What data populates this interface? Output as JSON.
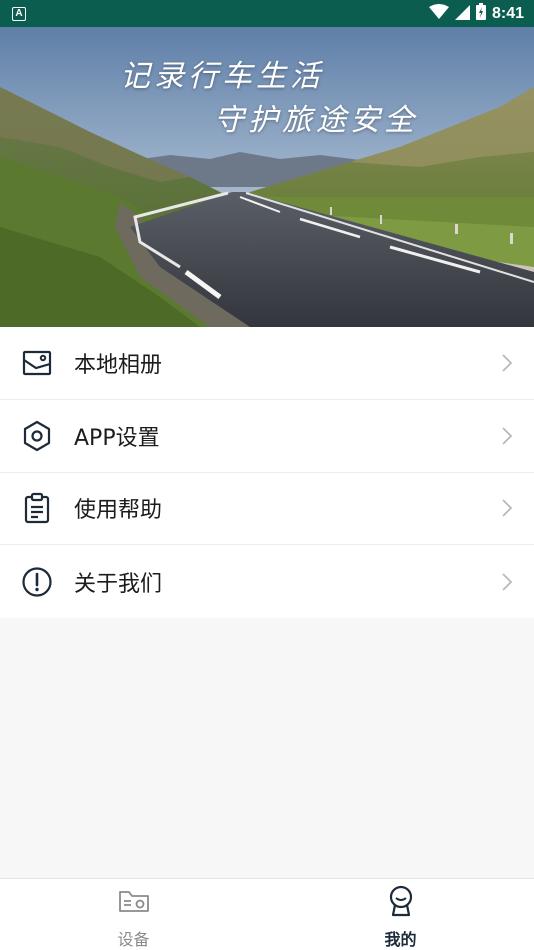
{
  "status_bar": {
    "notification_badge": "A",
    "time": "8:41",
    "icons": [
      "wifi-icon",
      "signal-icon",
      "battery-icon"
    ]
  },
  "hero": {
    "line1": "记录行车生活",
    "line2": "守护旅途安全"
  },
  "menu": {
    "items": [
      {
        "label": "本地相册",
        "icon": "photo-album-icon"
      },
      {
        "label": "APP设置",
        "icon": "settings-hexagon-icon"
      },
      {
        "label": "使用帮助",
        "icon": "clipboard-help-icon"
      },
      {
        "label": "关于我们",
        "icon": "info-circle-icon"
      }
    ]
  },
  "tab_bar": {
    "tabs": [
      {
        "label": "设备",
        "icon": "device-icon",
        "active": false
      },
      {
        "label": "我的",
        "icon": "profile-icon",
        "active": true
      }
    ]
  },
  "colors": {
    "status_bar": "#0b5d4f",
    "icon_navy": "#1c2a3a",
    "inactive_gray": "#8a8a8a",
    "background": "#f7f7f7"
  }
}
